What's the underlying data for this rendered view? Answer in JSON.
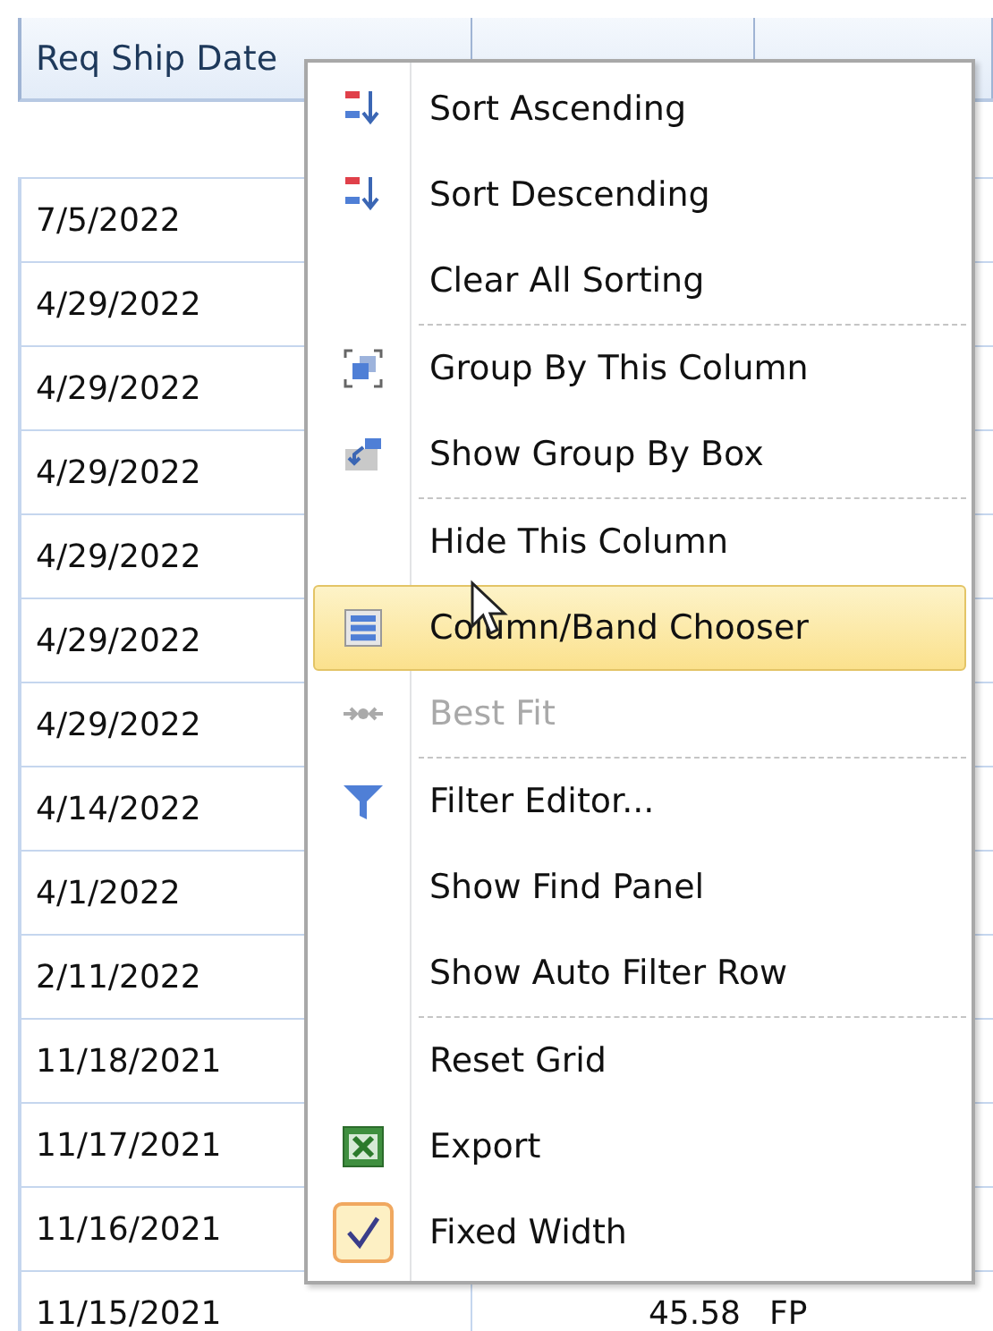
{
  "grid": {
    "columns": [
      {
        "label": "Req Ship Date"
      }
    ],
    "rows": [
      {
        "req_ship_date": "7/5/2022"
      },
      {
        "req_ship_date": "4/29/2022"
      },
      {
        "req_ship_date": "4/29/2022"
      },
      {
        "req_ship_date": "4/29/2022"
      },
      {
        "req_ship_date": "4/29/2022"
      },
      {
        "req_ship_date": "4/29/2022"
      },
      {
        "req_ship_date": "4/29/2022"
      },
      {
        "req_ship_date": "4/14/2022"
      },
      {
        "req_ship_date": "4/1/2022"
      },
      {
        "req_ship_date": "2/11/2022"
      },
      {
        "req_ship_date": "11/18/2021"
      },
      {
        "req_ship_date": "11/17/2021"
      },
      {
        "req_ship_date": "11/16/2021"
      },
      {
        "req_ship_date": "11/15/2021",
        "total": "45.58",
        "status": "FP"
      }
    ]
  },
  "context_menu": {
    "groups": [
      [
        {
          "label": "Sort Ascending",
          "selected": false,
          "disabled": false,
          "checked": false
        },
        {
          "label": "Sort Descending",
          "selected": false,
          "disabled": false,
          "checked": false
        },
        {
          "label": "Clear All Sorting",
          "selected": false,
          "disabled": false,
          "checked": false
        }
      ],
      [
        {
          "label": "Group By This Column",
          "selected": false,
          "disabled": false,
          "checked": false
        },
        {
          "label": "Show Group By Box",
          "selected": false,
          "disabled": false,
          "checked": false
        }
      ],
      [
        {
          "label": "Hide This Column",
          "selected": false,
          "disabled": false,
          "checked": false
        },
        {
          "label": "Column/Band Chooser",
          "selected": true,
          "disabled": false,
          "checked": false
        },
        {
          "label": "Best Fit",
          "selected": false,
          "disabled": true,
          "checked": false
        }
      ],
      [
        {
          "label": "Filter Editor...",
          "selected": false,
          "disabled": false,
          "checked": false
        },
        {
          "label": "Show Find Panel",
          "selected": false,
          "disabled": false,
          "checked": false
        },
        {
          "label": "Show Auto Filter Row",
          "selected": false,
          "disabled": false,
          "checked": false
        }
      ],
      [
        {
          "label": "Reset Grid",
          "selected": false,
          "disabled": false,
          "checked": false
        },
        {
          "label": "Export",
          "selected": false,
          "disabled": false,
          "checked": false
        },
        {
          "label": "Fixed Width",
          "selected": false,
          "disabled": false,
          "checked": true
        }
      ]
    ]
  }
}
